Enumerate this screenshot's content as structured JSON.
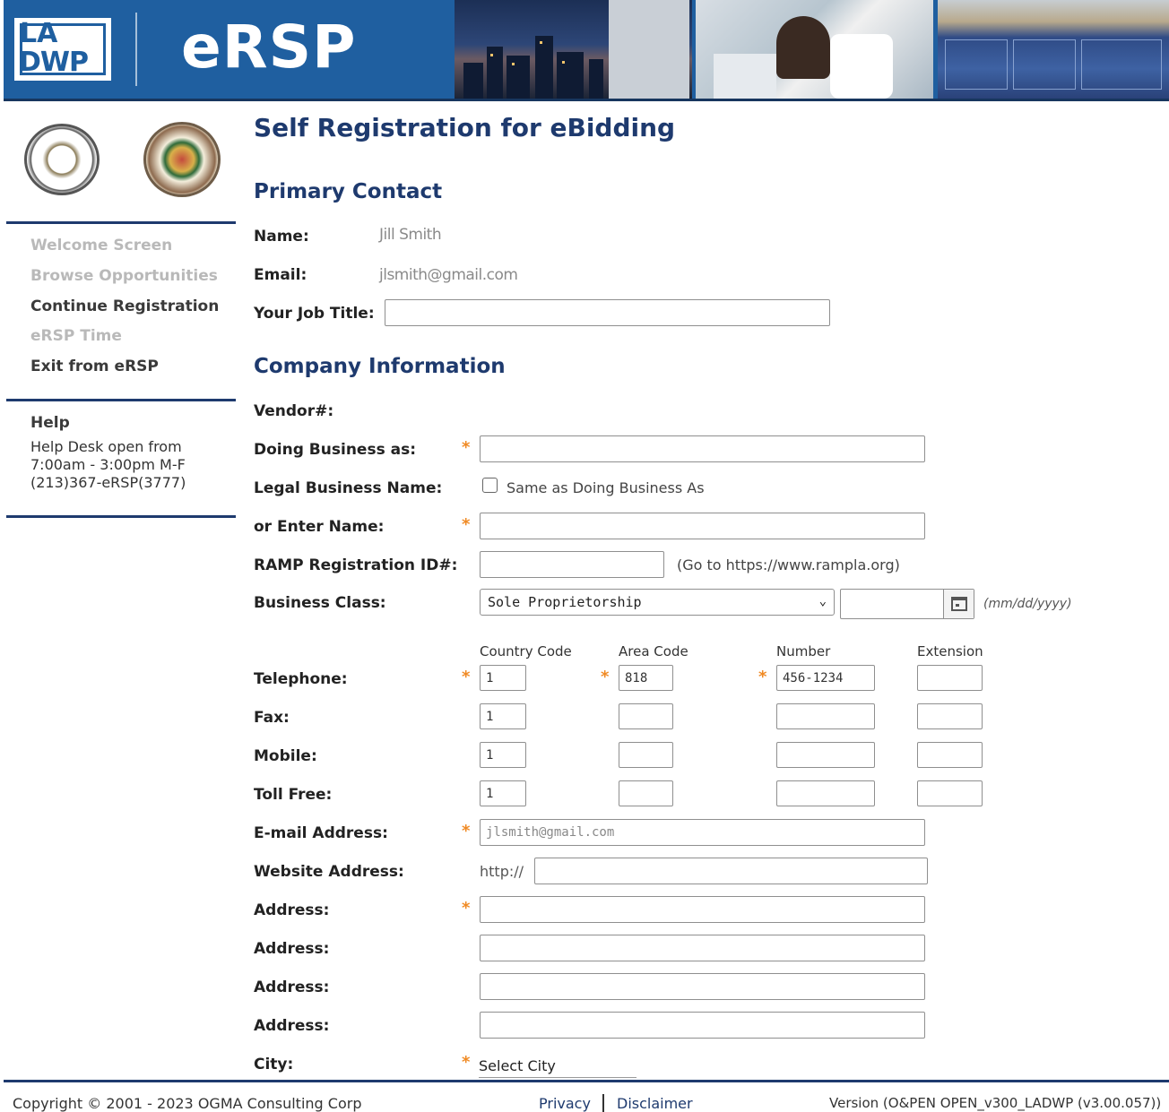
{
  "header": {
    "logo_line1": "LA",
    "logo_line2": "DWP",
    "app_title": "eRSP"
  },
  "sidebar": {
    "nav": [
      {
        "label": "Welcome Screen",
        "enabled": false
      },
      {
        "label": "Browse Opportunities",
        "enabled": false
      },
      {
        "label": "Continue Registration",
        "enabled": true
      },
      {
        "label": "eRSP Time",
        "enabled": false
      },
      {
        "label": "Exit from eRSP",
        "enabled": true
      }
    ],
    "help": {
      "title": "Help",
      "lines": [
        "Help Desk open from",
        "7:00am - 3:00pm M-F",
        "(213)367-eRSP(3777)"
      ]
    }
  },
  "page": {
    "title": "Self Registration for eBidding"
  },
  "primary_contact": {
    "section_title": "Primary Contact",
    "name_label": "Name:",
    "name_value": "Jill Smith",
    "email_label": "Email:",
    "email_value": "jlsmith@gmail.com",
    "job_title_label": "Your Job Title:",
    "job_title_value": ""
  },
  "company": {
    "section_title": "Company Information",
    "vendor_label": "Vendor#:",
    "dba_label": "Doing Business as:",
    "dba_value": "",
    "legal_name_label": "Legal Business Name:",
    "same_as_dba_label": "Same as Doing Business As",
    "same_as_dba_checked": false,
    "enter_name_label": "or Enter Name:",
    "enter_name_value": "",
    "ramp_label": "RAMP Registration ID#:",
    "ramp_value": "",
    "ramp_hint": "(Go to https://www.rampla.org)",
    "business_class_label": "Business Class:",
    "business_class_value": "Sole Proprietorship",
    "date_value": "",
    "date_hint": "(mm/dd/yyyy)",
    "phone_columns": [
      "Country Code",
      "Area Code",
      "Number",
      "Extension"
    ],
    "telephone_label": "Telephone:",
    "telephone": {
      "country": "1",
      "area": "818",
      "number": "456-1234",
      "ext": ""
    },
    "fax_label": "Fax:",
    "fax": {
      "country": "1",
      "area": "",
      "number": "",
      "ext": ""
    },
    "mobile_label": "Mobile:",
    "mobile": {
      "country": "1",
      "area": "",
      "number": "",
      "ext": ""
    },
    "tollfree_label": "Toll Free:",
    "tollfree": {
      "country": "1",
      "area": "",
      "number": "",
      "ext": ""
    },
    "email_label": "E-mail Address:",
    "email_value": "jlsmith@gmail.com",
    "website_label": "Website Address:",
    "website_prefix": "http://",
    "website_value": "",
    "address_label": "Address:",
    "addresses": [
      "",
      "",
      "",
      ""
    ],
    "city_label": "City:",
    "city_value": "Select City"
  },
  "footer": {
    "copyright": "Copyright © 2001 - 2023 OGMA Consulting Corp",
    "privacy": "Privacy",
    "disclaimer": "Disclaimer",
    "version": "Version (O&PEN OPEN_v300_LADWP (v3.00.057))"
  },
  "colors": {
    "brand_blue": "#1f5fa0",
    "heading_navy": "#1e3a6e",
    "required_orange": "#f08a24",
    "disabled_gray": "#b9b9b9"
  }
}
